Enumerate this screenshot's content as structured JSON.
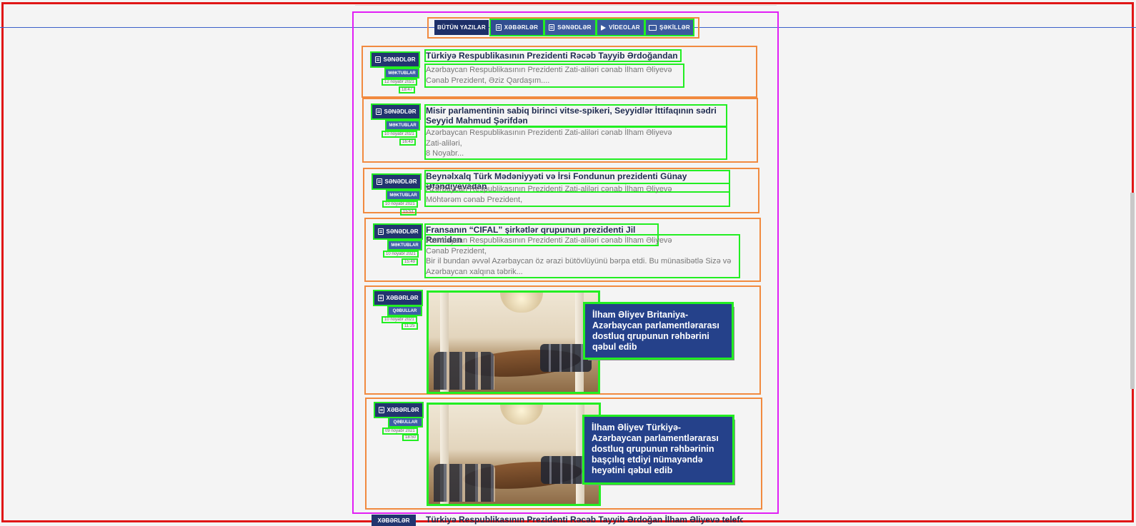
{
  "tabs": [
    {
      "label": "BÜTÜN YAZILAR",
      "icon": ""
    },
    {
      "label": "XƏBƏRLƏR",
      "icon": "document-icon"
    },
    {
      "label": "SƏNƏDLƏR",
      "icon": "document-icon"
    },
    {
      "label": "VİDEOLAR",
      "icon": "play-icon"
    },
    {
      "label": "ŞƏKİLLƏR",
      "icon": "screen-icon"
    }
  ],
  "posts": [
    {
      "category": "Sənədlər",
      "subcategory": "MƏKTUBLAR",
      "date": "12 noyabr 2021",
      "time": "18:47",
      "title": "Türkiyə Respublikasının Prezidenti Rəcəb Tayyib Ərdoğandan",
      "excerpt": [
        "Azərbaycan Respublikasının Prezidenti Zati-aliləri cənab İlham Əliyevə",
        "Cənab Prezident, Əziz Qardaşım...."
      ]
    },
    {
      "category": "Sənədlər",
      "subcategory": "MƏKTUBLAR",
      "date": "10 noyabr 2021",
      "time": "16:43",
      "title": "Misir parlamentinin sabiq birinci vitse-spikeri, Seyyidlər İttifaqının sədri Seyyid Mahmud Şərifdən",
      "excerpt": [
        "Azərbaycan Respublikasının Prezidenti Zati-aliləri cənab İlham Əliyevə",
        "Zati-aliləri,",
        "8 Noyabr..."
      ]
    },
    {
      "category": "Sənədlər",
      "subcategory": "MƏKTUBLAR",
      "date": "10 noyabr 2021",
      "time": "15:51",
      "title": "Beynəlxalq Türk Mədəniyyəti və İrsi Fondunun prezidenti Günay Əfəndiyevadan",
      "excerpt": [
        "Azərbaycan Respublikasının Prezidenti Zati-aliləri cənab İlham Əliyevə",
        "Möhtərəm cənab Prezident,"
      ]
    },
    {
      "category": "Sənədlər",
      "subcategory": "MƏKTUBLAR",
      "date": "10 noyabr 2021",
      "time": "15:49",
      "title": "Fransanın “CIFAL” şirkətlər qrupunun prezidenti Jil Remidən",
      "excerpt": [
        "Azərbaycan Respublikasının Prezidenti Zati-aliləri cənab İlham Əliyevə",
        "Cənab Prezident,",
        "Bir il bundan əvvəl Azərbaycan öz ərazi bütövlüyünü bərpa etdi. Bu münasibətlə Sizə və",
        "Azərbaycan xalqına təbrik..."
      ]
    },
    {
      "category": "Xəbərlər",
      "subcategory": "QƏBULLAR",
      "date": "10 noyabr 2021",
      "time": "11:25",
      "title": "İlham Əliyev Britaniya-Azərbaycan parlamentlərarası dostluq qrupunun rəhbərini qəbul edib",
      "image_alt": "meeting-photo"
    },
    {
      "category": "Xəbərlər",
      "subcategory": "QƏBULLAR",
      "date": "09 noyabr 2021",
      "time": "18:50",
      "title": "İlham Əliyev Türkiyə-Azərbaycan parlamentlərarası dostluq qrupunun rəhbərinin başçılıq etdiyi nümayəndə heyətini qəbul edib",
      "image_alt": "meeting-photo"
    }
  ],
  "next_post": {
    "category": "Xəbərlər",
    "title": "Türkiyə Respublikasının Prezidenti Rəcəb Tayyib Ərdoğan İlham Əliyevə telefonla zəng"
  },
  "colors": {
    "accent": "#24407e",
    "highlight": "#22ee22",
    "outline": "#f18a3f"
  }
}
